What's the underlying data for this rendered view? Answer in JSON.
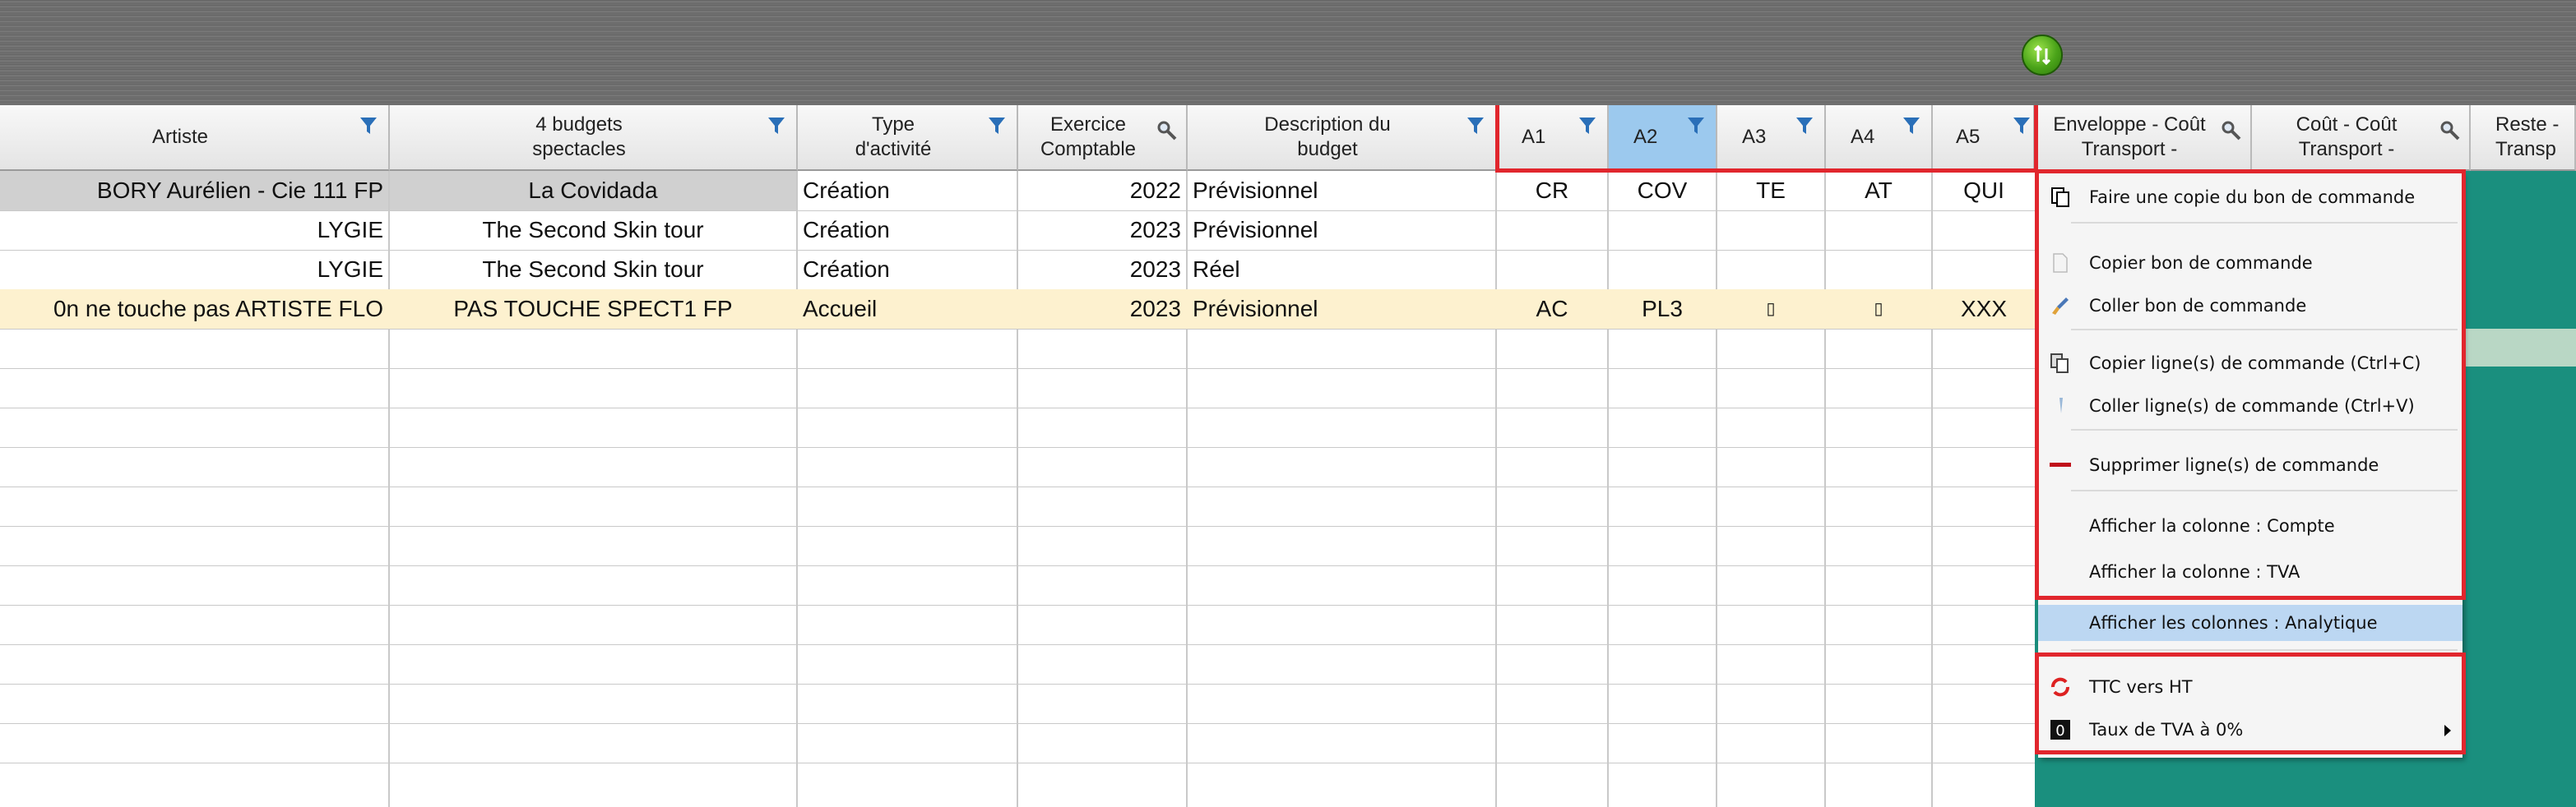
{
  "grid": {
    "headers": {
      "artiste": "Artiste",
      "budgets": "4 budgets spectacles",
      "type": "Type d'activité",
      "exercice": "Exercice Comptable",
      "description": "Description du budget",
      "a1": "A1",
      "a2": "A2",
      "a3": "A3",
      "a4": "A4",
      "a5": "A5",
      "enveloppe": "Enveloppe - Coût Transport -",
      "cout": "Coût - Coût Transport -",
      "reste": "Reste - Transp"
    },
    "rows": [
      {
        "artiste": "BORY Aurélien - Cie 111 FP",
        "budget": "La Covidada",
        "type": "Création",
        "exercice": "2022",
        "description": "Prévisionnel",
        "a1": "CR",
        "a2": "COV",
        "a3": "TE",
        "a4": "AT",
        "a5": "QUI"
      },
      {
        "artiste": "LYGIE",
        "budget": "The Second Skin tour",
        "type": "Création",
        "exercice": "2023",
        "description": "Prévisionnel",
        "a1": "",
        "a2": "",
        "a3": "",
        "a4": "",
        "a5": ""
      },
      {
        "artiste": "LYGIE",
        "budget": "The Second Skin tour",
        "type": "Création",
        "exercice": "2023",
        "description": "Réel",
        "a1": "",
        "a2": "",
        "a3": "",
        "a4": "",
        "a5": ""
      },
      {
        "artiste": "0n ne touche pas ARTISTE FLO",
        "budget": "PAS TOUCHE SPECT1 FP",
        "type": "Accueil",
        "exercice": "2023",
        "description": "Prévisionnel",
        "a1": "AC",
        "a2": "PL3",
        "a3": "▯",
        "a4": "▯",
        "a5": "XXX"
      }
    ]
  },
  "context_menu": {
    "items": [
      {
        "label": "Faire une copie du bon de commande",
        "icon": "copy-document-icon"
      },
      {
        "label": "Copier bon de commande",
        "icon": "document-icon"
      },
      {
        "label": "Coller bon de commande",
        "icon": "brush-icon"
      },
      {
        "label": "Copier ligne(s) de commande (Ctrl+C)",
        "icon": "copy-lines-icon"
      },
      {
        "label": "Coller ligne(s) de commande (Ctrl+V)",
        "icon": "paste-icon"
      },
      {
        "label": "Supprimer ligne(s) de commande",
        "icon": "delete-line-icon"
      },
      {
        "label": "Afficher la colonne : Compte",
        "icon": ""
      },
      {
        "label": "Afficher la colonne : TVA",
        "icon": ""
      },
      {
        "label": "Afficher les colonnes : Analytique",
        "icon": ""
      },
      {
        "label": "TTC vers HT",
        "icon": "convert-icon"
      },
      {
        "label": "Taux de TVA à 0%",
        "icon": "zero-icon"
      }
    ]
  },
  "colors": {
    "highlight_box": "#e1262d",
    "selected_header": "#9cc9ee",
    "selected_row": "#fdf1cf",
    "gray_row": "#d0d0d0",
    "teal": "#1a8f7e",
    "menu_highlight": "#bcd7f2"
  }
}
